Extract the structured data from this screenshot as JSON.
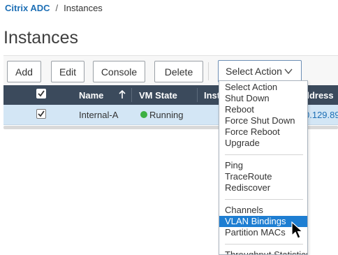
{
  "breadcrumb": {
    "root": "Citrix ADC",
    "separator": "/",
    "current": "Instances"
  },
  "page_title": "Instances",
  "toolbar": {
    "add_label": "Add",
    "edit_label": "Edit",
    "console_label": "Console",
    "delete_label": "Delete",
    "select_action_label": "Select Action"
  },
  "table": {
    "columns": {
      "name": "Name",
      "vm_state": "VM State",
      "instance": "Inst",
      "address": "ddress"
    },
    "rows": [
      {
        "checked": true,
        "name": "Internal-A",
        "vm_state": "Running",
        "ip_address": "0.129.89"
      }
    ]
  },
  "action_menu": {
    "items": [
      "Select Action",
      "Shut Down",
      "Reboot",
      "Force Shut Down",
      "Force Reboot",
      "Upgrade",
      "Ping",
      "TraceRoute",
      "Rediscover",
      "Channels",
      "VLAN Bindings",
      "Partition MACs",
      "Throughput Statistics"
    ],
    "highlighted": "VLAN Bindings"
  },
  "colors": {
    "header_bg": "#3b4a5c",
    "selected_row_bg": "#d3e6f5",
    "menu_highlight": "#1e7ed2",
    "running_status": "#3cb043",
    "link_blue": "#1d6fb5"
  },
  "icons": {
    "sort": "sort-ascending-arrow-icon",
    "dropdown": "chevron-down-icon",
    "status": "status-dot-icon",
    "cursor": "mouse-pointer-icon"
  }
}
